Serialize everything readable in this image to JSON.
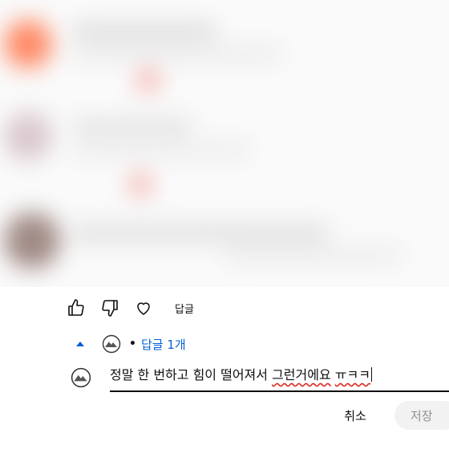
{
  "comment_actions": {
    "reply_label": "답글",
    "like_icon": "thumbs-up-icon",
    "dislike_icon": "thumbs-down-icon",
    "heart_icon": "heart-outline-icon"
  },
  "replies": {
    "count_label": "답글 1개",
    "separator": "•",
    "toggle_icon": "caret-up-icon",
    "accent_color": "#065fd4"
  },
  "composer": {
    "text_prefix": "정말 한 번하고 힘이 떨어져서 ",
    "text_flagged_1": "그런거에요",
    "text_space": " ",
    "text_flagged_2": "ㅠㅋㅋ",
    "cancel_label": "취소",
    "save_label": "저장"
  }
}
